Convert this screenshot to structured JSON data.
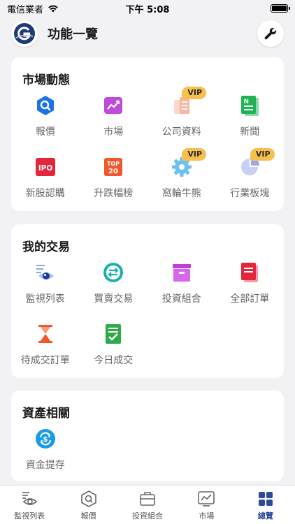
{
  "status_bar": {
    "carrier": "電信業者",
    "time": "下午 5:08"
  },
  "header": {
    "title": "功能一覽"
  },
  "colors": {
    "accent": "#2b4a9c",
    "vip": "#f6c04f",
    "background": "#f2f2f5"
  },
  "market": {
    "title": "市場動態",
    "items": [
      {
        "label": "報價",
        "icon": "quote-search-icon"
      },
      {
        "label": "市場",
        "icon": "market-chart-icon"
      },
      {
        "label": "公司資料",
        "icon": "company-docs-icon",
        "badge": "VIP"
      },
      {
        "label": "新聞",
        "icon": "news-icon"
      },
      {
        "label": "新股認購",
        "icon": "ipo-icon",
        "icon_text": "IPO"
      },
      {
        "label": "升跌幅榜",
        "icon": "top20-icon",
        "icon_text_1": "TOP",
        "icon_text_2": "20"
      },
      {
        "label": "窩輪牛熊",
        "icon": "warrant-gear-icon",
        "badge": "VIP"
      },
      {
        "label": "行業板塊",
        "icon": "sector-pie-icon",
        "badge": "VIP"
      }
    ]
  },
  "trade": {
    "title": "我的交易",
    "items": [
      {
        "label": "監視列表",
        "icon": "watchlist-eye-icon"
      },
      {
        "label": "買賣交易",
        "icon": "trade-exchange-icon"
      },
      {
        "label": "投資組合",
        "icon": "portfolio-box-icon"
      },
      {
        "label": "全部訂單",
        "icon": "all-orders-icon"
      },
      {
        "label": "待成交訂單",
        "icon": "pending-hourglass-icon"
      },
      {
        "label": "今日成交",
        "icon": "today-filled-icon"
      }
    ]
  },
  "assets": {
    "title": "資產相關",
    "items": [
      {
        "label": "資金提存",
        "icon": "fund-transfer-icon"
      }
    ]
  },
  "tabs": [
    {
      "label": "監視列表",
      "icon": "watchlist-tab-icon"
    },
    {
      "label": "報價",
      "icon": "quote-tab-icon"
    },
    {
      "label": "投資組合",
      "icon": "portfolio-tab-icon"
    },
    {
      "label": "市場",
      "icon": "market-tab-icon"
    },
    {
      "label": "總覽",
      "icon": "overview-tab-icon",
      "active": true
    }
  ]
}
